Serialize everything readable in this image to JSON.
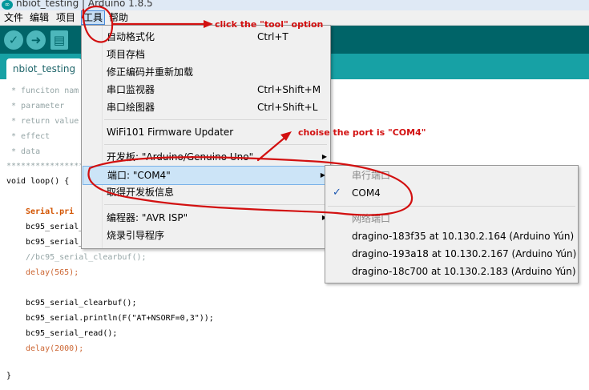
{
  "window": {
    "title": "nbiot_testing | Arduino 1.8.5",
    "icon": "arduino-logo-icon",
    "icon_text": "∞"
  },
  "menubar": {
    "items": [
      "文件",
      "编辑",
      "项目",
      "工具",
      "帮助"
    ],
    "active": "工具"
  },
  "toolbar": {
    "buttons": [
      "verify-icon",
      "upload-icon",
      "new-icon"
    ]
  },
  "tabs": [
    {
      "label": "nbiot_testing"
    }
  ],
  "tools_menu": {
    "items": [
      {
        "label": "自动格式化",
        "shortcut": "Ctrl+T"
      },
      {
        "label": "项目存档",
        "shortcut": ""
      },
      {
        "label": "修正编码并重新加载",
        "shortcut": ""
      },
      {
        "label": "串口监视器",
        "shortcut": "Ctrl+Shift+M"
      },
      {
        "label": "串口绘图器",
        "shortcut": "Ctrl+Shift+L"
      },
      {
        "label": "WiFi101 Firmware Updater",
        "shortcut": ""
      },
      {
        "label": "开发板: \"Arduino/Genuino Uno\"",
        "submenu": true
      },
      {
        "label": "端口: \"COM4\"",
        "submenu": true,
        "highlighted": true
      },
      {
        "label": "取得开发板信息",
        "shortcut": ""
      },
      {
        "label": "编程器: \"AVR ISP\"",
        "submenu": true
      },
      {
        "label": "烧录引导程序",
        "shortcut": ""
      }
    ]
  },
  "port_submenu": {
    "serial_header": "串行端口",
    "selected_port": "COM4",
    "network_header": "网络端口",
    "network_ports": [
      "dragino-183f35 at 10.130.2.164 (Arduino Yún)",
      "dragino-193a18 at 10.130.2.167 (Arduino Yún)",
      "dragino-18c700 at 10.130.2.183 (Arduino Yún)"
    ]
  },
  "code_comments": [
    " * funciton nam",
    " * parameter",
    " * return value",
    " * effect",
    " * data",
    "*****************"
  ],
  "code": {
    "loop_decl": "void loop() {",
    "serial_print": "Serial.pri",
    "bc95_a": "bc95_serial_",
    "bc95_b": "bc95_serial_",
    "commented_clearbuf": "//bc95_serial_clearbuf();",
    "delay_a": "delay(565);",
    "clearbuf": "bc95_serial_clearbuf();",
    "println": "bc95_serial.println(F(\"AT+NSORF=0,3\"));",
    "read": "bc95_serial_read();",
    "delay_b": "delay(2000);",
    "closing": "}"
  },
  "annotations": {
    "tool": "click the \"tool\" option",
    "port": "choise the port is \"COM4\""
  },
  "colors": {
    "accent_teal": "#00979c",
    "toolbar": "#006468",
    "tabbar": "#17a1a5",
    "annotation": "#d21010"
  }
}
